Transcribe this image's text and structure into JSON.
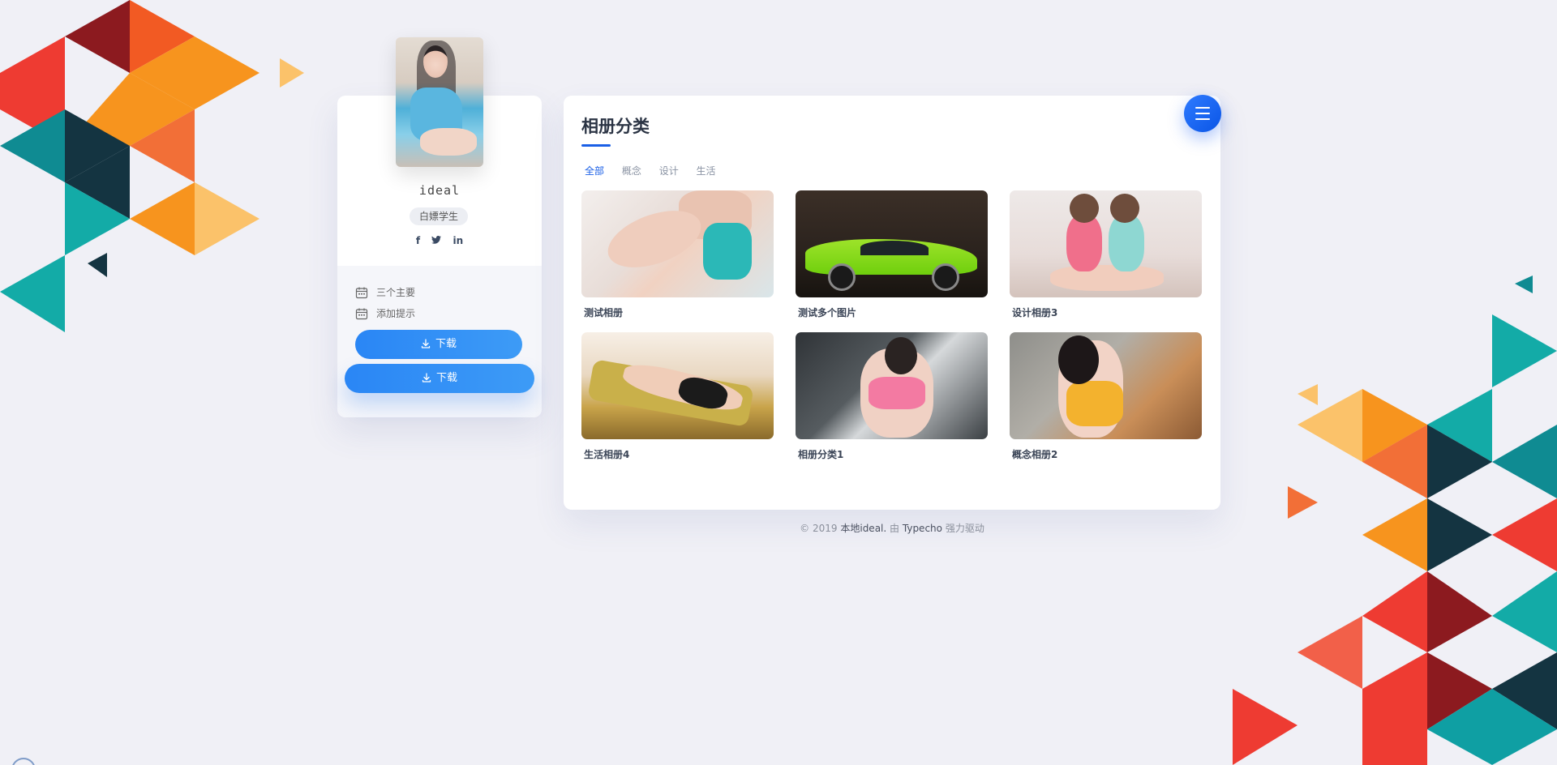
{
  "profile": {
    "username": "ideal",
    "badge": "白嫖学生",
    "social_icons": [
      "facebook-icon",
      "twitter-icon",
      "linkedin-icon"
    ],
    "social_glyphs": [
      "f",
      "🐦",
      "in"
    ],
    "info_items": [
      {
        "icon": "calendar-icon",
        "label": "三个主要"
      },
      {
        "icon": "calendar-icon",
        "label": "添加提示"
      }
    ],
    "download_buttons": [
      {
        "icon": "download-icon",
        "label": "下载"
      },
      {
        "icon": "download-icon",
        "label": "下载"
      }
    ]
  },
  "album": {
    "title": "相册分类",
    "menu_icon": "menu-icon",
    "tabs": [
      {
        "label": "全部",
        "active": true
      },
      {
        "label": "概念",
        "active": false
      },
      {
        "label": "设计",
        "active": false
      },
      {
        "label": "生活",
        "active": false
      }
    ],
    "items": [
      {
        "title": "测试相册"
      },
      {
        "title": "测试多个图片"
      },
      {
        "title": "设计相册3"
      },
      {
        "title": "生活相册4"
      },
      {
        "title": "相册分类1"
      },
      {
        "title": "概念相册2"
      }
    ]
  },
  "footer": {
    "copyright": "© 2019",
    "site": "本地ideal.",
    "by": "由",
    "engine": "Typecho",
    "powered": "强力驱动"
  },
  "colors": {
    "accent": "#1a5fe6",
    "button": "#2a86f5",
    "background": "#f0f0f6"
  }
}
